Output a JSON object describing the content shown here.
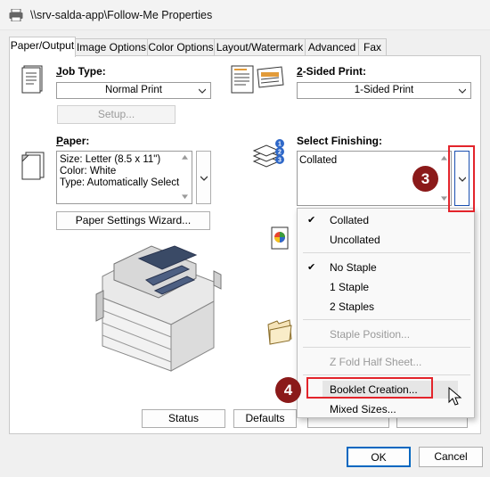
{
  "window": {
    "title": "\\\\srv-salda-app\\Follow-Me Properties",
    "icon": "printer-icon"
  },
  "tabs": [
    {
      "label": "Paper/Output",
      "active": true
    },
    {
      "label": "Image Options"
    },
    {
      "label": "Color Options"
    },
    {
      "label": "Layout/Watermark"
    },
    {
      "label": "Advanced"
    },
    {
      "label": "Fax"
    }
  ],
  "job_type": {
    "label": "Job Type:",
    "value": "Normal Print",
    "setup_label": "Setup..."
  },
  "two_sided": {
    "label": "2-Sided Print:",
    "value": "1-Sided Print"
  },
  "paper": {
    "label": "Paper:",
    "lines": [
      "Size: Letter (8.5 x 11\")",
      "Color: White",
      "Type: Automatically Select"
    ],
    "wizard_label": "Paper Settings Wizard..."
  },
  "finishing": {
    "label": "Select Finishing:",
    "badge_lines": [
      "1",
      "2",
      "3"
    ],
    "value": "Collated"
  },
  "menu": {
    "items": [
      {
        "label": "Collated",
        "checked": true
      },
      {
        "label": "Uncollated"
      },
      {
        "label": "No Staple",
        "checked": true
      },
      {
        "label": "1 Staple"
      },
      {
        "label": "2 Staples"
      },
      {
        "label": "Staple Position...",
        "disabled": true
      },
      {
        "label": "Z Fold Half Sheet...",
        "disabled": true
      },
      {
        "label": "Booklet Creation..."
      },
      {
        "label": "Mixed Sizes..."
      }
    ]
  },
  "annotations": {
    "step3": "3",
    "step4": "4",
    "highlight_color": "#e3242b",
    "badge_color": "#8b1a1a"
  },
  "bottom_buttons": {
    "status": "Status",
    "defaults": "Defaults"
  },
  "footer": {
    "ok": "OK",
    "cancel": "Cancel"
  }
}
